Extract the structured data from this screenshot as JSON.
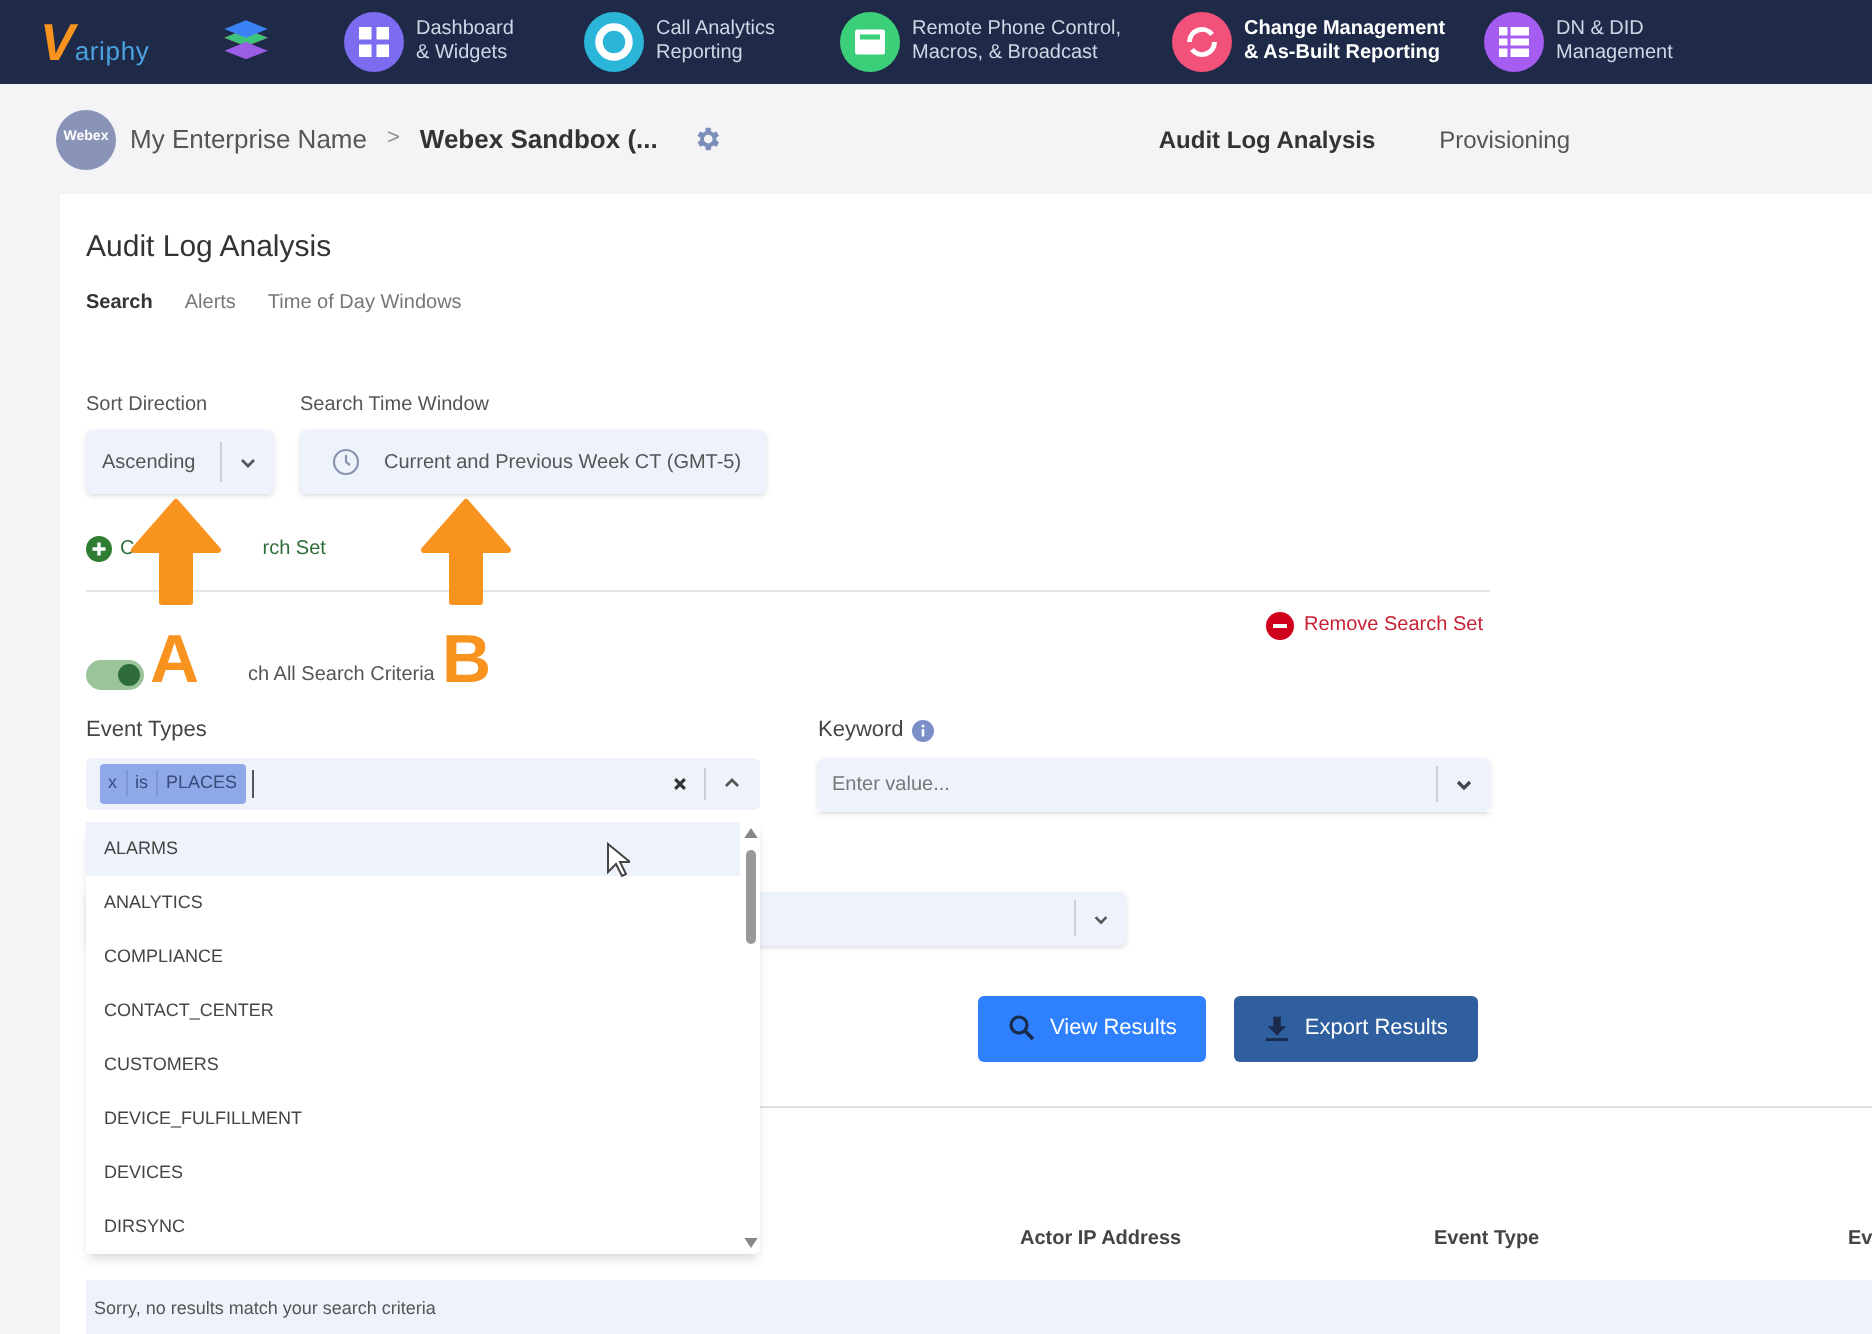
{
  "nav": {
    "logo_letter": "V",
    "logo_text": "ariphy",
    "items": [
      {
        "lines": [
          "Dashboard",
          "& Widgets"
        ],
        "color": "#7b6cf0",
        "kind": "grid",
        "selected": false
      },
      {
        "lines": [
          "Call Analytics",
          "Reporting"
        ],
        "color": "#2bb5d8",
        "kind": "ring",
        "selected": false
      },
      {
        "lines": [
          "Remote Phone Control,",
          "Macros, & Broadcast"
        ],
        "color": "#3ccf7a",
        "kind": "phone",
        "selected": false
      },
      {
        "lines": [
          "Change Management",
          "& As-Built Reporting"
        ],
        "color": "#f2527a",
        "kind": "cycle",
        "selected": true
      },
      {
        "lines": [
          "DN & DID",
          "Management"
        ],
        "color": "#a55cf0",
        "kind": "list",
        "selected": false
      }
    ]
  },
  "subbar": {
    "avatar": "Webex",
    "breadcrumb": [
      "My Enterprise Name",
      "Webex Sandbox (..."
    ],
    "separator": ">",
    "tabs": [
      {
        "label": "Audit Log Analysis",
        "selected": true
      },
      {
        "label": "Provisioning",
        "selected": false
      }
    ]
  },
  "page": {
    "title": "Audit Log Analysis",
    "tabs": [
      {
        "label": "Search",
        "selected": true
      },
      {
        "label": "Alerts",
        "selected": false
      },
      {
        "label": "Time of Day Windows",
        "selected": false
      }
    ],
    "sort_direction": {
      "label": "Sort Direction",
      "value": "Ascending"
    },
    "time_window": {
      "label": "Search Time Window",
      "value": "Current and Previous Week CT (GMT-5)"
    },
    "create_search_set": [
      "C",
      "rch Set"
    ],
    "remove_search_set": "Remove Search Set",
    "match_all": {
      "label": "ch All Search Criteria",
      "on": true
    },
    "event_types": {
      "label": "Event Types",
      "chip": [
        "x",
        "is",
        "PLACES"
      ],
      "expanded": true,
      "options": [
        {
          "label": "ALARMS",
          "selected": true
        },
        {
          "label": "ANALYTICS",
          "selected": false
        },
        {
          "label": "COMPLIANCE",
          "selected": false
        },
        {
          "label": "CONTACT_CENTER",
          "selected": false
        },
        {
          "label": "CUSTOMERS",
          "selected": false
        },
        {
          "label": "DEVICE_FULFILLMENT",
          "selected": false
        },
        {
          "label": "DEVICES",
          "selected": false
        },
        {
          "label": "DIRSYNC",
          "selected": false
        }
      ]
    },
    "keyword": {
      "label": "Keyword",
      "placeholder": "Enter value..."
    },
    "buttons": [
      {
        "label": "View Results",
        "kind": "search"
      },
      {
        "label": "Export Results",
        "kind": "export"
      }
    ],
    "table": {
      "columns": [
        "Actor IP Address",
        "Event Type",
        "Ev"
      ],
      "empty": "Sorry, no results match your search criteria"
    }
  },
  "annotations": [
    {
      "label": "A"
    },
    {
      "label": "B"
    }
  ]
}
